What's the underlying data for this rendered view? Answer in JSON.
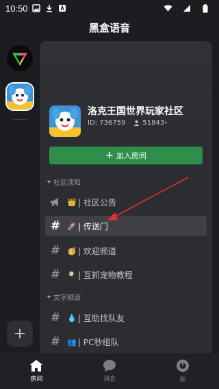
{
  "status_bar": {
    "time": "10:50",
    "icons": [
      "download-icon",
      "notification-icon",
      "wifi-icon",
      "signal-icon",
      "battery-icon"
    ]
  },
  "app": {
    "title": "黑盒语音"
  },
  "rail": {
    "servers": [
      {
        "name": "logo-server",
        "icon": "triangle-logo"
      },
      {
        "name": "active-server",
        "icon": "cartoon-avatar",
        "selected": true
      }
    ],
    "add_icon": "plus-icon"
  },
  "community": {
    "name": "洛克王国世界玩家社区",
    "id_text": "ID: 736759",
    "members": "51843",
    "member_chevron": "›"
  },
  "join_button": {
    "plus": "+",
    "label": "加入房间"
  },
  "categories": [
    {
      "label": "社区须知"
    },
    {
      "label": "文字频道"
    }
  ],
  "channels": [
    {
      "icon": "megaphone-icon",
      "emoji": "👑",
      "label": "| 社区公告"
    },
    {
      "icon": "hash",
      "hash": "#",
      "emoji": "🚀",
      "label": "| 传送门",
      "selected": true
    },
    {
      "icon": "hash",
      "hash": "#",
      "emoji": "🥳",
      "label": "| 欢迎频道"
    },
    {
      "icon": "hash",
      "hash": "#",
      "emoji": "🍳",
      "label": "| 互抓宠物教程"
    },
    {
      "icon": "hash",
      "hash": "#",
      "emoji": "💧",
      "label": "| 互助找队友"
    },
    {
      "icon": "hash",
      "hash": "#",
      "emoji": "👥",
      "label": "| PC秒组队"
    }
  ],
  "bottom_nav": [
    {
      "label": "房间",
      "icon": "home-icon",
      "active": true
    },
    {
      "label": "消息",
      "icon": "chat-bubble-icon",
      "active": false
    },
    {
      "label": "我",
      "icon": "profile-icon",
      "active": false
    }
  ],
  "colors": {
    "background": "#1c1d20",
    "panel": "#2b2d31",
    "join_green": "#2f8f4a",
    "selected_row": "#3f4147",
    "annotation_red": "#e0302a"
  }
}
